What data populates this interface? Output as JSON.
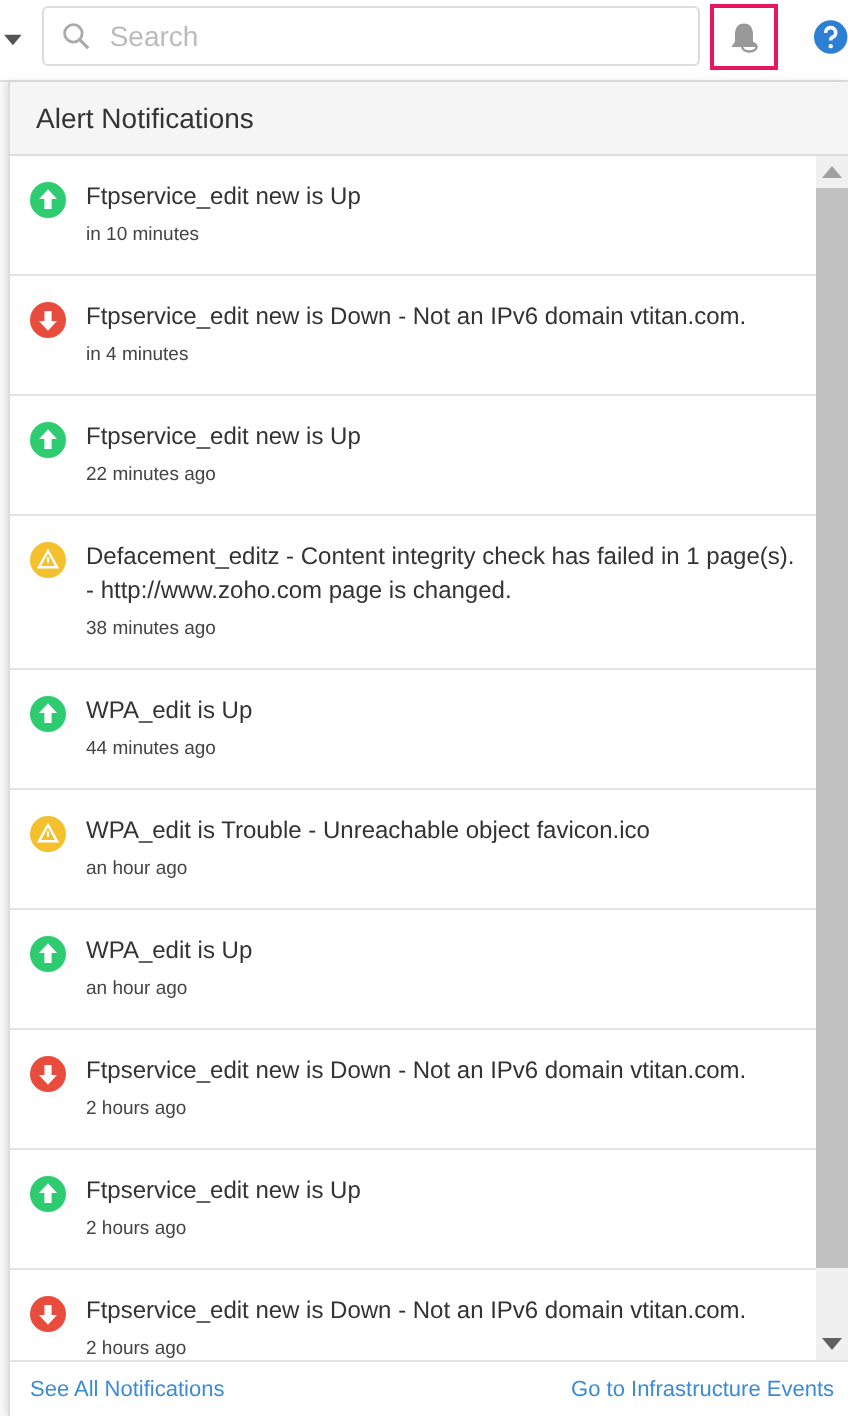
{
  "search": {
    "placeholder": "Search"
  },
  "panel": {
    "title": "Alert Notifications"
  },
  "notifications": [
    {
      "kind": "up",
      "message": "Ftpservice_edit new is Up",
      "time": "in 10 minutes"
    },
    {
      "kind": "down",
      "message": "Ftpservice_edit new is Down - Not an IPv6 domain vtitan.com.",
      "time": "in 4 minutes"
    },
    {
      "kind": "up",
      "message": "Ftpservice_edit new is Up",
      "time": "22 minutes ago"
    },
    {
      "kind": "trouble",
      "message": "Defacement_editz - Content integrity check has failed in 1 page(s). - http://www.zoho.com page is changed.",
      "time": "38 minutes ago"
    },
    {
      "kind": "up",
      "message": "WPA_edit is Up",
      "time": "44 minutes ago"
    },
    {
      "kind": "trouble",
      "message": "WPA_edit is Trouble - Unreachable object favicon.ico",
      "time": "an hour ago"
    },
    {
      "kind": "up",
      "message": "WPA_edit is Up",
      "time": "an hour ago"
    },
    {
      "kind": "down",
      "message": "Ftpservice_edit new is Down - Not an IPv6 domain vtitan.com.",
      "time": "2 hours ago"
    },
    {
      "kind": "up",
      "message": "Ftpservice_edit new is Up",
      "time": "2 hours ago"
    },
    {
      "kind": "down",
      "message": "Ftpservice_edit new is Down - Not an IPv6 domain vtitan.com.",
      "time": "2 hours ago"
    }
  ],
  "footer": {
    "left_link": "See All Notifications",
    "right_link": "Go to Infrastructure Events"
  }
}
